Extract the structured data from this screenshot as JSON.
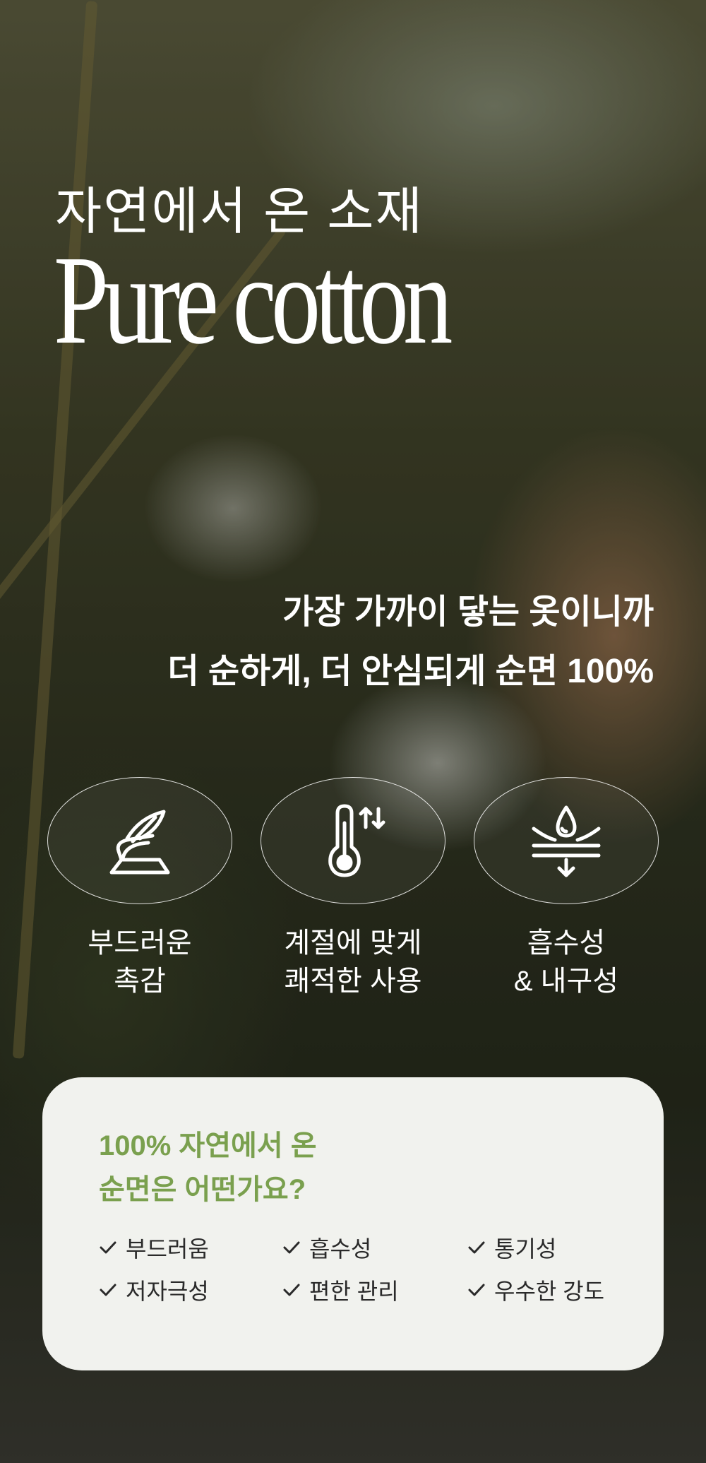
{
  "hero": {
    "subtitle": "자연에서 온 소재",
    "headline": "Pure cotton",
    "tagline_line1": "가장 가까이 닿는 옷이니까",
    "tagline_line2": "더 순하게, 더 안심되게 순면 100%"
  },
  "features": [
    {
      "icon": "feather-on-fabric-icon",
      "line1": "부드러운",
      "line2": "촉감"
    },
    {
      "icon": "thermometer-icon",
      "line1": "계절에 맞게",
      "line2": "쾌적한 사용"
    },
    {
      "icon": "water-drop-absorb-icon",
      "line1": "흡수성",
      "line2": "& 내구성"
    }
  ],
  "card": {
    "title_line1": "100% 자연에서 온",
    "title_line2": "순면은 어떤가요?",
    "benefits": [
      "부드러움",
      "흡수성",
      "통기성",
      "저자극성",
      "편한 관리",
      "우수한 강도"
    ],
    "accent_color": "#7aa04e"
  }
}
